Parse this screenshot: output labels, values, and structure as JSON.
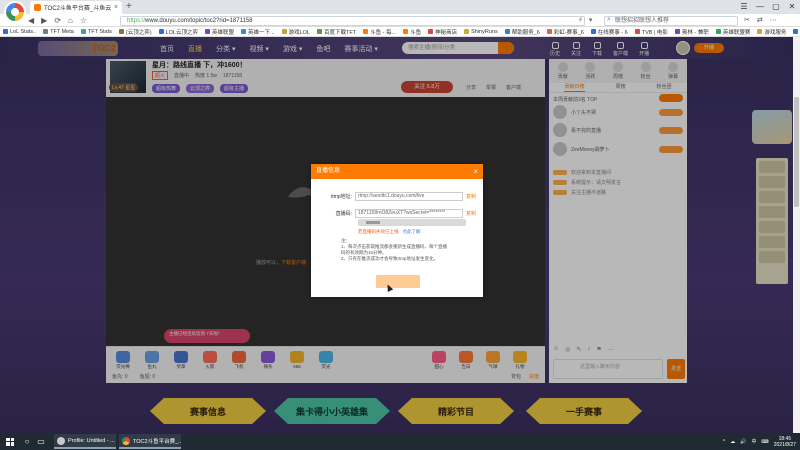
{
  "browser": {
    "tab_title": "TOC2斗鱼平台赛_斗鱼云顶之弈",
    "tab_close": "×",
    "new_tab": "+",
    "window_controls": [
      "☰",
      "—",
      "▢",
      "✕"
    ],
    "nav_buttons": [
      "◀",
      "▶",
      "⟳",
      "⌂",
      "☆"
    ],
    "url_scheme": "https://",
    "url": "www.douyu.com/topic/toc2?rid=1871158",
    "url_icons": [
      "⚡",
      "▾"
    ],
    "search_placeholder": "联想招招联想人推荐",
    "right_icons": [
      "✂",
      "⇄",
      "⋯"
    ]
  },
  "bookmarks": [
    {
      "label": "LoL Stats..",
      "color": "#2d6cdf"
    },
    {
      "label": "TFT Meta",
      "color": "#6b7f8f"
    },
    {
      "label": "TFT Stats",
      "color": "#3aa0a0"
    },
    {
      "label": "(云顶之弈)",
      "color": "#9a6a3a"
    },
    {
      "label": "LOL云顶之弈",
      "color": "#2d6cdf"
    },
    {
      "label": "英雄联盟",
      "color": "#8a3ac4"
    },
    {
      "label": "英雄一下...",
      "color": "#3a8ad6"
    },
    {
      "label": "游戏LOL",
      "color": "#c2a23a"
    },
    {
      "label": "百度下载TFT",
      "color": "#5a9a3a"
    },
    {
      "label": "斗鱼 - 每...",
      "color": "#ff7a00"
    },
    {
      "label": "斗鱼",
      "color": "#ff7a00"
    },
    {
      "label": "神秘商店",
      "color": "#d04a4a"
    },
    {
      "label": "ShinyRuns",
      "color": "#caa83a"
    },
    {
      "label": "帮助服务_6",
      "color": "#3a7ad6"
    },
    {
      "label": "彩虹-赛事_6",
      "color": "#d46a3a"
    },
    {
      "label": "在线赛事 - 6",
      "color": "#2d6cdf"
    },
    {
      "label": "TVB | 电影",
      "color": "#d04a4a"
    },
    {
      "label": "奥林 - 兼职",
      "color": "#6a4ac4"
    },
    {
      "label": "英雄联盟赛",
      "color": "#3aa05a"
    },
    {
      "label": "游戏服务",
      "color": "#caa83a"
    },
    {
      "label": "(Super)奔跑",
      "color": "#2d6cdf"
    },
    {
      "label": "王者荣耀",
      "color": "#d04a4a"
    }
  ],
  "site": {
    "logo_text": "斗鱼",
    "logo_accent": "TOC2",
    "nav": [
      "首页",
      "直播",
      "分类 ▾",
      "视频 ▾",
      "游戏 ▾",
      "鱼吧",
      "赛事活动 ▾"
    ],
    "search_placeholder": "搜索主播/房间/分类",
    "header_icons": [
      "历史",
      "关注",
      "下载",
      "客户端",
      "开播"
    ],
    "header_button": "开播"
  },
  "room": {
    "title": "星月：路线直播 下，冲1600！",
    "meta": [
      "直播中",
      "热度 1.5w",
      "1871158"
    ],
    "hot_label": "超火",
    "tags": [
      "超级热舞",
      "云顶之弈",
      "超级主播"
    ],
    "rank": "Lv.47 星星",
    "follow_label": "关注 5.8万",
    "actions": [
      "分享",
      "举报",
      "客户端"
    ]
  },
  "video": {
    "tip_prefix": "播放可以，",
    "tip_link": "下载客户端",
    "notice": "主播已经连续签到 7天啦！"
  },
  "gifts": [
    {
      "label": "荧光棒",
      "color": "#5a8de0"
    },
    {
      "label": "鱼丸",
      "color": "#6ca1e6"
    },
    {
      "label": "奖章",
      "color": "#4a77d3"
    },
    {
      "label": "火箭",
      "color": "#ff6b5a"
    },
    {
      "label": "飞机",
      "color": "#f26a3c"
    },
    {
      "label": "辣条",
      "color": "#8a5ad8"
    },
    {
      "label": "666",
      "color": "#f5b42a"
    },
    {
      "label": "荧光",
      "color": "#4cb9e6"
    }
  ],
  "gifts_right": [
    {
      "label": "甜心",
      "color": "#ff5e8a"
    },
    {
      "label": "告白",
      "color": "#ff7a3a"
    },
    {
      "label": "气球",
      "color": "#ffa43a"
    },
    {
      "label": "礼物",
      "color": "#ffb82a"
    }
  ],
  "giftbar_bottom": {
    "left": [
      "鱼丸: 0",
      "鱼翅: 0"
    ],
    "right": [
      "背包",
      "充值"
    ]
  },
  "sidebar": {
    "top_icons": [
      "贡献",
      "活跃",
      "周榜",
      "粉丝",
      "弹幕"
    ],
    "tabs": [
      "贡献日榜",
      "周榜",
      "粉丝团"
    ],
    "ranking_title": "本周贡献前3名 TOP",
    "rank_items": [
      "小丫头不哭",
      "看不完的直播",
      "ZeeMoney胡萝卜"
    ],
    "chat_lines": [
      "欢迎来到本直播间",
      "系统提示：请文明发言",
      "关注主播不迷路"
    ],
    "bottom_icons": [
      "☺",
      "◎",
      "✎",
      "♪",
      "⚑",
      "…"
    ],
    "chat_placeholder": "这里输入聊天内容",
    "send_label": "发送"
  },
  "banners": [
    "赛事信息",
    "集卡得小小英雄集",
    "精彩节目",
    "一手赛事"
  ],
  "modal": {
    "title": "直播信息",
    "close": "×",
    "rtmp_label": "rtmp地址:",
    "rtmp_value": "rtmp://sendtc1.douyu.com/live",
    "key_label": "直播码:",
    "key_value": "1871158rnO8ZeuXT?wsSecret=********",
    "copy_label": "复制",
    "warning": "若直播码失效已上线",
    "warning_link": "点此了解",
    "notes": [
      "注：",
      "1、每次点击获取推流都会重新生成直播码，每个直播",
      "   码的有效期为15分钟。",
      "2、只有在推流成功才会导致rtmp地址发生变化。"
    ]
  },
  "taskbar": {
    "apps": [
      "Profile: Untitled - ...",
      "TOC2斗鱼平台赛_..."
    ],
    "tray_icons": [
      "^",
      "☁",
      "🔊",
      "中",
      "⌨"
    ],
    "time": "18:45",
    "date": "2021/8/27"
  }
}
